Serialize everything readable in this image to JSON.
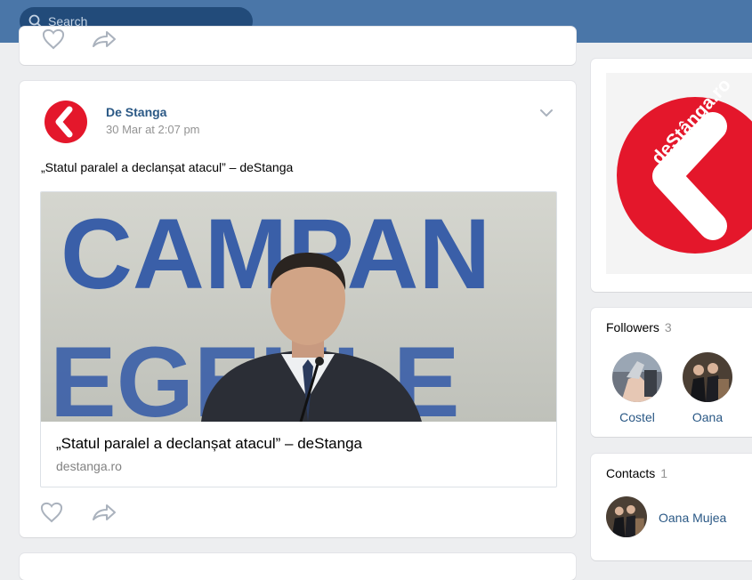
{
  "header": {
    "search_placeholder": "Search"
  },
  "post": {
    "author": "De Stanga",
    "time": "30 Mar at 2:07 pm",
    "text": "„Statul paralel a declanșat atacul” – deStanga",
    "attachment": {
      "photo_text": "CAMPAN",
      "photo_text2": "EGEULE",
      "title": "„Statul paralel a declanșat atacul” – deStanga",
      "domain": "destanga.ro"
    }
  },
  "sidebar": {
    "logo_text": "deStânga.ro",
    "followers": {
      "title": "Followers",
      "count": "3",
      "people": [
        {
          "name": "Costel"
        },
        {
          "name": "Oana"
        }
      ]
    },
    "contacts": {
      "title": "Contacts",
      "count": "1",
      "people": [
        {
          "name": "Oana Mujea"
        }
      ]
    }
  },
  "colors": {
    "header_bg": "#4a76a8",
    "link": "#2a5885",
    "brand_red": "#e4172b",
    "page_bg": "#edeef0"
  },
  "icons": {
    "search": "search-icon",
    "like": "heart-icon",
    "share": "share-arrow-icon",
    "menu": "chevron-down-icon"
  }
}
